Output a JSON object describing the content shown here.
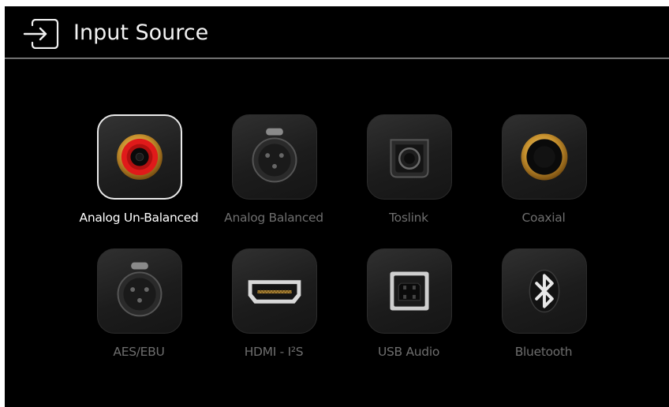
{
  "header": {
    "title": "Input Source",
    "icon": "input-source-icon"
  },
  "sources": [
    {
      "label": "Analog Un-Balanced",
      "icon": "rca-icon",
      "selected": true
    },
    {
      "label": "Analog Balanced",
      "icon": "xlr-icon",
      "selected": false
    },
    {
      "label": "Toslink",
      "icon": "optical-icon",
      "selected": false
    },
    {
      "label": "Coaxial",
      "icon": "coaxial-icon",
      "selected": false
    },
    {
      "label": "AES/EBU",
      "icon": "xlr-icon",
      "selected": false
    },
    {
      "label": "HDMI - I²S",
      "icon": "hdmi-icon",
      "selected": false
    },
    {
      "label": "USB Audio",
      "icon": "usb-b-icon",
      "selected": false
    },
    {
      "label": "Bluetooth",
      "icon": "bluetooth-icon",
      "selected": false
    }
  ],
  "colors": {
    "background": "#000000",
    "selected_border": "#eaeaea",
    "label_selected": "#ffffff",
    "label_unselected": "#6e6e6e",
    "rca_red": "#e01a1a",
    "gold": "#c8922e"
  }
}
